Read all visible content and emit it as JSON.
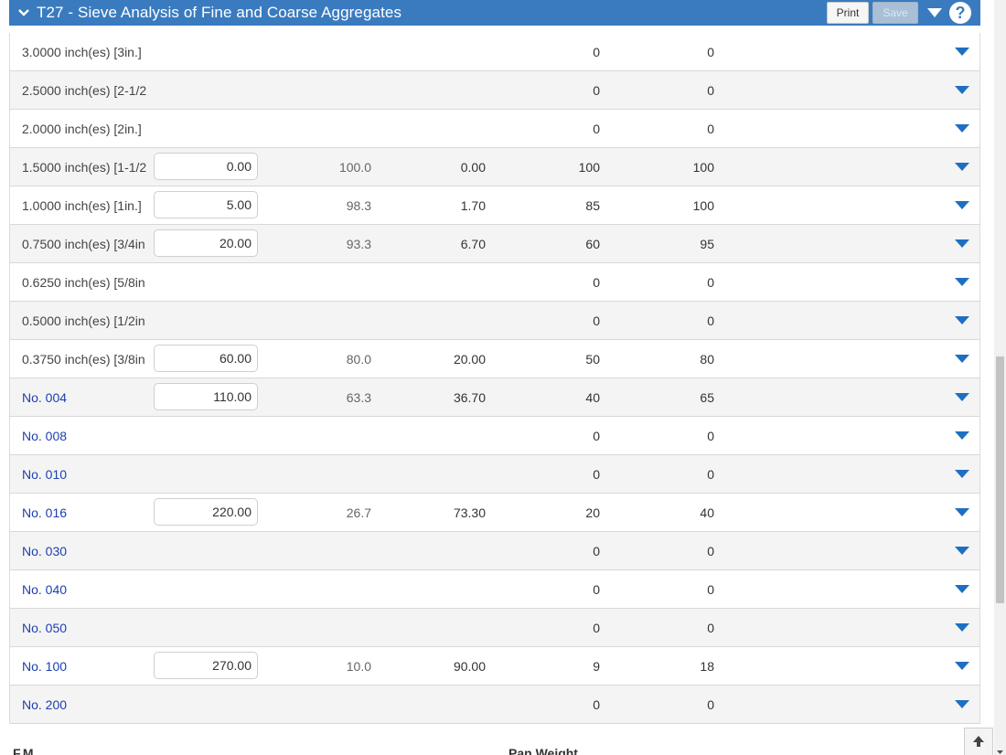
{
  "header": {
    "title": "T27 - Sieve Analysis of Fine and Coarse Aggregates",
    "print_label": "Print",
    "save_label": "Save"
  },
  "rows": [
    {
      "sieve": "3.0000 inch(es) [3in.]",
      "weight": "",
      "pass": "",
      "retained": "",
      "min": "0",
      "max": "0",
      "link": false
    },
    {
      "sieve": "2.5000 inch(es) [2-1/2",
      "weight": "",
      "pass": "",
      "retained": "",
      "min": "0",
      "max": "0",
      "link": false
    },
    {
      "sieve": "2.0000 inch(es) [2in.]",
      "weight": "",
      "pass": "",
      "retained": "",
      "min": "0",
      "max": "0",
      "link": false
    },
    {
      "sieve": "1.5000 inch(es) [1-1/2",
      "weight": "0.00",
      "pass": "100.0",
      "retained": "0.00",
      "min": "100",
      "max": "100",
      "link": false
    },
    {
      "sieve": "1.0000 inch(es) [1in.]",
      "weight": "5.00",
      "pass": "98.3",
      "retained": "1.70",
      "min": "85",
      "max": "100",
      "link": false
    },
    {
      "sieve": "0.7500 inch(es) [3/4in",
      "weight": "20.00",
      "pass": "93.3",
      "retained": "6.70",
      "min": "60",
      "max": "95",
      "link": false
    },
    {
      "sieve": "0.6250 inch(es) [5/8in",
      "weight": "",
      "pass": "",
      "retained": "",
      "min": "0",
      "max": "0",
      "link": false
    },
    {
      "sieve": "0.5000 inch(es) [1/2in",
      "weight": "",
      "pass": "",
      "retained": "",
      "min": "0",
      "max": "0",
      "link": false
    },
    {
      "sieve": "0.3750 inch(es) [3/8in",
      "weight": "60.00",
      "pass": "80.0",
      "retained": "20.00",
      "min": "50",
      "max": "80",
      "link": false
    },
    {
      "sieve": "No. 004",
      "weight": "110.00",
      "pass": "63.3",
      "retained": "36.70",
      "min": "40",
      "max": "65",
      "link": true
    },
    {
      "sieve": "No. 008",
      "weight": "",
      "pass": "",
      "retained": "",
      "min": "0",
      "max": "0",
      "link": true
    },
    {
      "sieve": "No. 010",
      "weight": "",
      "pass": "",
      "retained": "",
      "min": "0",
      "max": "0",
      "link": true
    },
    {
      "sieve": "No. 016",
      "weight": "220.00",
      "pass": "26.7",
      "retained": "73.30",
      "min": "20",
      "max": "40",
      "link": true
    },
    {
      "sieve": "No. 030",
      "weight": "",
      "pass": "",
      "retained": "",
      "min": "0",
      "max": "0",
      "link": true
    },
    {
      "sieve": "No. 040",
      "weight": "",
      "pass": "",
      "retained": "",
      "min": "0",
      "max": "0",
      "link": true
    },
    {
      "sieve": "No. 050",
      "weight": "",
      "pass": "",
      "retained": "",
      "min": "0",
      "max": "0",
      "link": true
    },
    {
      "sieve": "No. 100",
      "weight": "270.00",
      "pass": "10.0",
      "retained": "90.00",
      "min": "9",
      "max": "18",
      "link": true
    },
    {
      "sieve": "No. 200",
      "weight": "",
      "pass": "",
      "retained": "",
      "min": "0",
      "max": "0",
      "link": true
    }
  ],
  "footer": {
    "fm_label": "F.M.",
    "pan_weight_label": "Pan Weight"
  },
  "colors": {
    "header_bg": "#3a7bbf",
    "link": "#1c3fb2",
    "caret": "#1f6fc0"
  },
  "icons": {
    "header_collapse": "chevron-down-icon",
    "header_menu": "caret-down-icon",
    "help": "help-icon",
    "row_menu": "caret-down-icon",
    "scroll_top": "arrow-up-icon"
  }
}
